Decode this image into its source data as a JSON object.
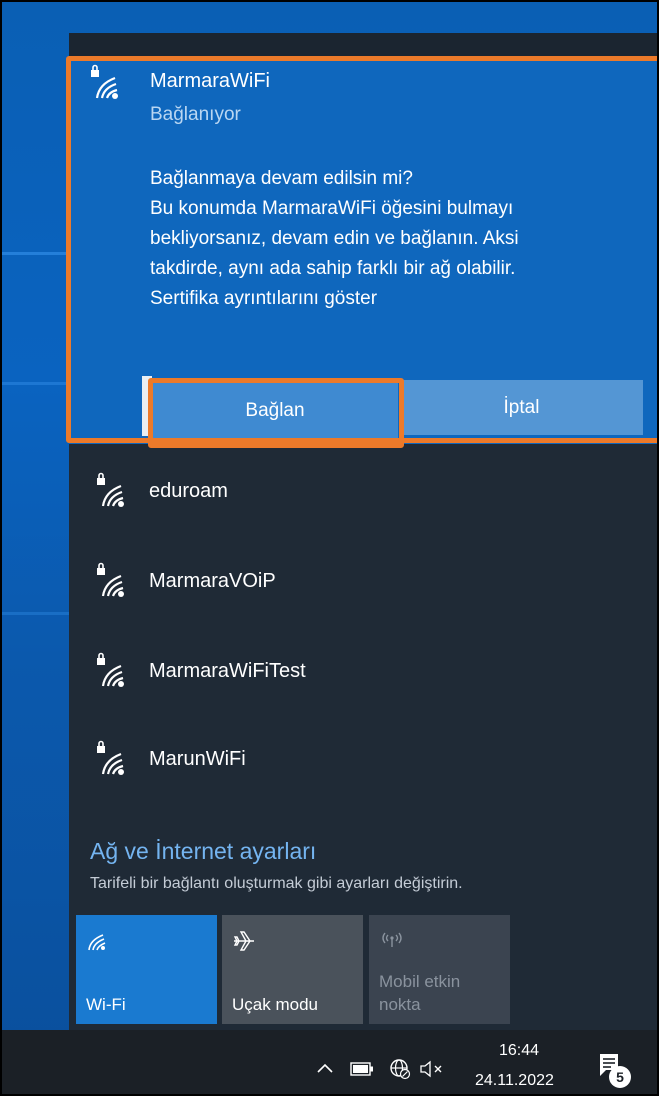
{
  "selected_network": {
    "name": "MarmaraWiFi",
    "status": "Bağlanıyor",
    "message_lines": [
      "Bağlanmaya devam edilsin mi?",
      "Bu konumda MarmaraWiFi öğesini bulmayı",
      "bekliyorsanız, devam edin ve bağlanın. Aksi",
      "takdirde, aynı ada sahip farklı bir ağ olabilir.",
      "Sertifika ayrıntılarını göster"
    ],
    "connect_label": "Bağlan",
    "cancel_label": "İptal"
  },
  "networks": [
    {
      "name": "eduroam"
    },
    {
      "name": "MarmaraVOiP"
    },
    {
      "name": "MarmaraWiFiTest"
    },
    {
      "name": "MarunWiFi"
    }
  ],
  "settings": {
    "link": "Ağ ve İnternet ayarları",
    "description": "Tarifeli bir bağlantı oluşturmak gibi ayarları değiştirin."
  },
  "quick_actions": {
    "wifi": "Wi-Fi",
    "airplane": "Uçak modu",
    "hotspot_line1": "Mobil etkin",
    "hotspot_line2": "nokta"
  },
  "taskbar": {
    "time": "16:44",
    "date": "24.11.2022",
    "notification_count": "5",
    "icons": [
      "chevron-up-icon",
      "battery-icon",
      "globe-icon",
      "volume-muted-icon",
      "action-center-icon"
    ]
  },
  "colors": {
    "accent": "#0f67bd",
    "highlight": "#ec7a2a",
    "flyout_bg": "#1f2a36",
    "link": "#74b4f0"
  }
}
